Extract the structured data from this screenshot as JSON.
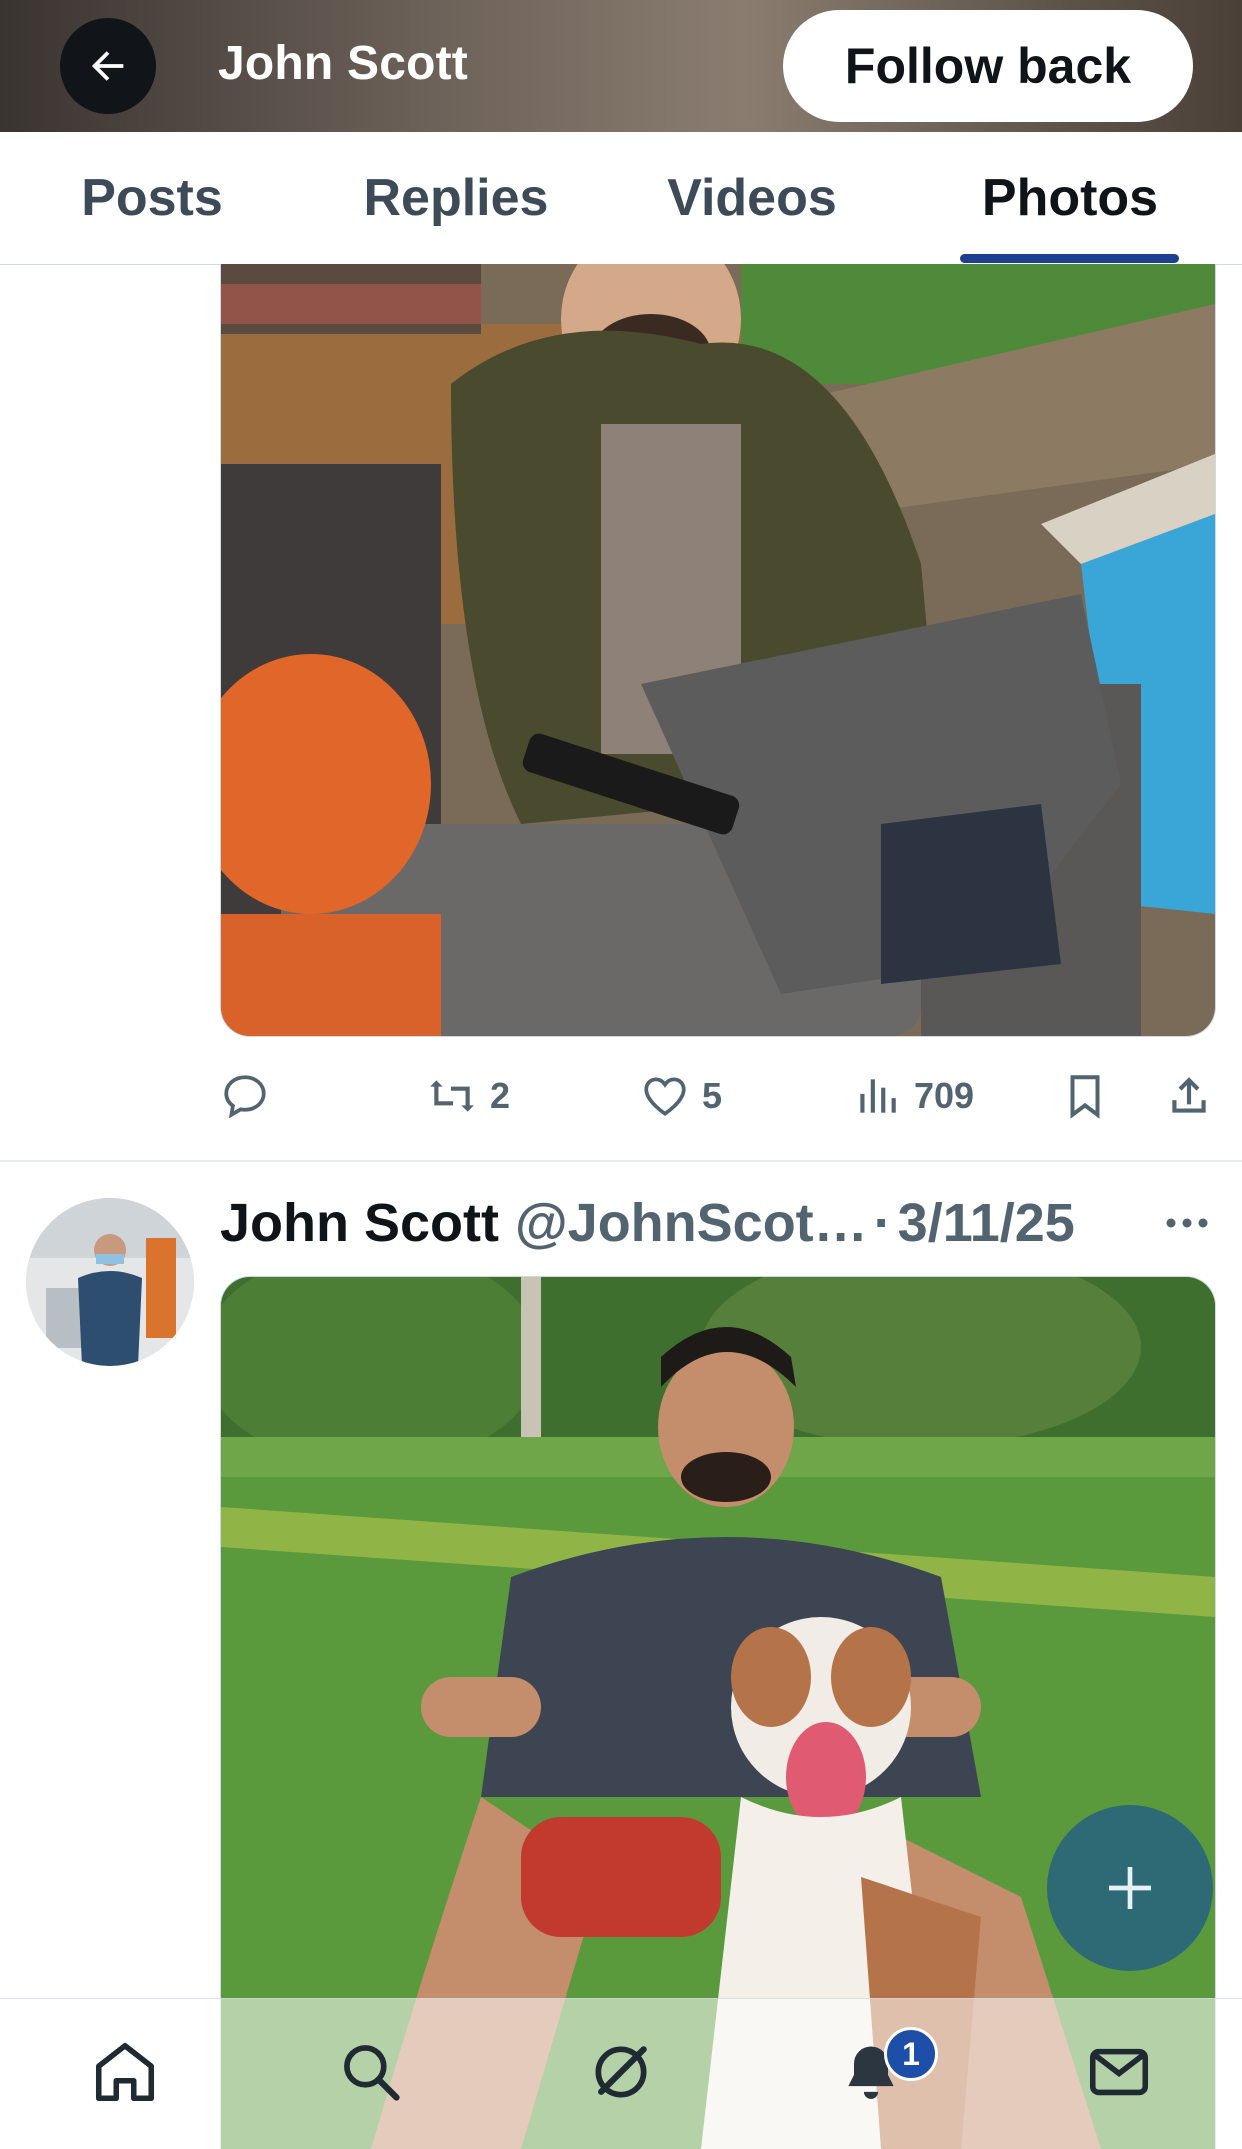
{
  "header": {
    "back_icon": "arrow-left-icon",
    "name": "John Scott",
    "follow_label": "Follow back"
  },
  "tabs": [
    {
      "label": "Posts",
      "active": false
    },
    {
      "label": "Replies",
      "active": false
    },
    {
      "label": "Videos",
      "active": false
    },
    {
      "label": "Photos",
      "active": true
    }
  ],
  "post1": {
    "photo_description": "man in green parka smiling on sofa by pool",
    "actions": {
      "reply_icon": "comment-icon",
      "repost_icon": "repost-icon",
      "repost_count": "2",
      "like_icon": "heart-icon",
      "like_count": "5",
      "views_icon": "views-icon",
      "view_count": "709",
      "bookmark_icon": "bookmark-icon",
      "share_icon": "share-icon"
    }
  },
  "post2": {
    "name": "John Scott",
    "handle": "@JohnScot…",
    "separator": "·",
    "date": "3/11/25",
    "more_icon": "more-icon"
  },
  "fab": {
    "icon": "plus-icon"
  },
  "bottom_nav": {
    "items": [
      "home-icon",
      "search-icon",
      "grok-icon",
      "notifications-icon",
      "messages-icon"
    ],
    "notification_badge": "1"
  },
  "colors": {
    "accent": "#1d3f8f",
    "muted_text": "#536471",
    "fab": "#1d588c"
  }
}
